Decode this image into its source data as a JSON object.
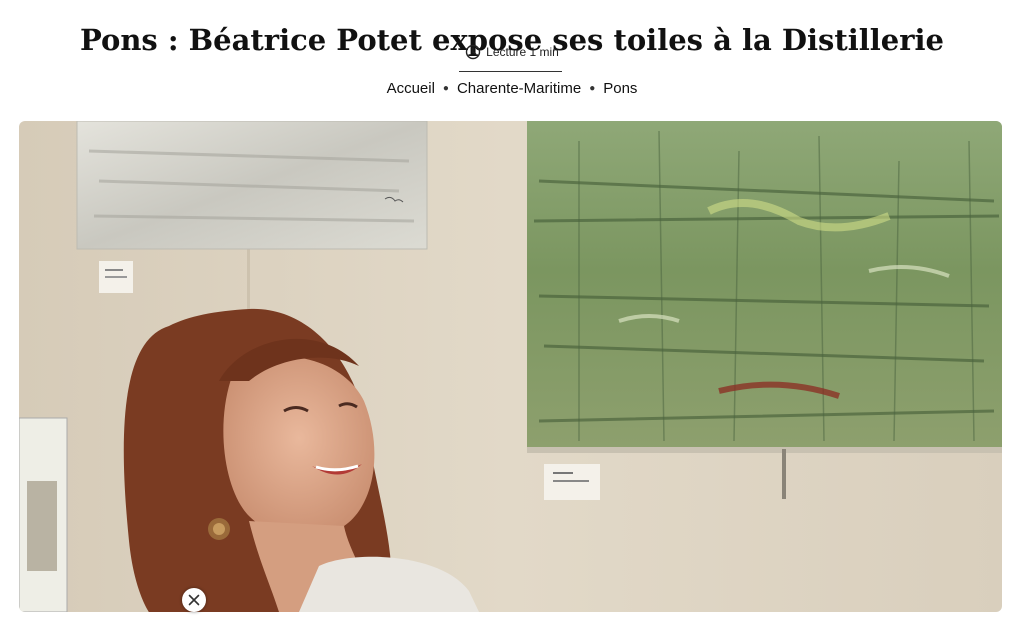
{
  "article": {
    "title": "Pons : Béatrice Potet expose ses toiles à la Distillerie",
    "reading_time": "Lecture 1 min"
  },
  "breadcrumb": [
    {
      "label": "Accueil"
    },
    {
      "label": "Charente-Maritime"
    },
    {
      "label": "Pons"
    }
  ],
  "icons": {
    "reading_time": "clock-icon",
    "breadcrumb_separator": "bullet-icon",
    "dismiss": "close-icon"
  },
  "colors": {
    "wall": "#ddd3c2",
    "painting_green": "#7f9a62",
    "hair": "#7a3b22"
  }
}
